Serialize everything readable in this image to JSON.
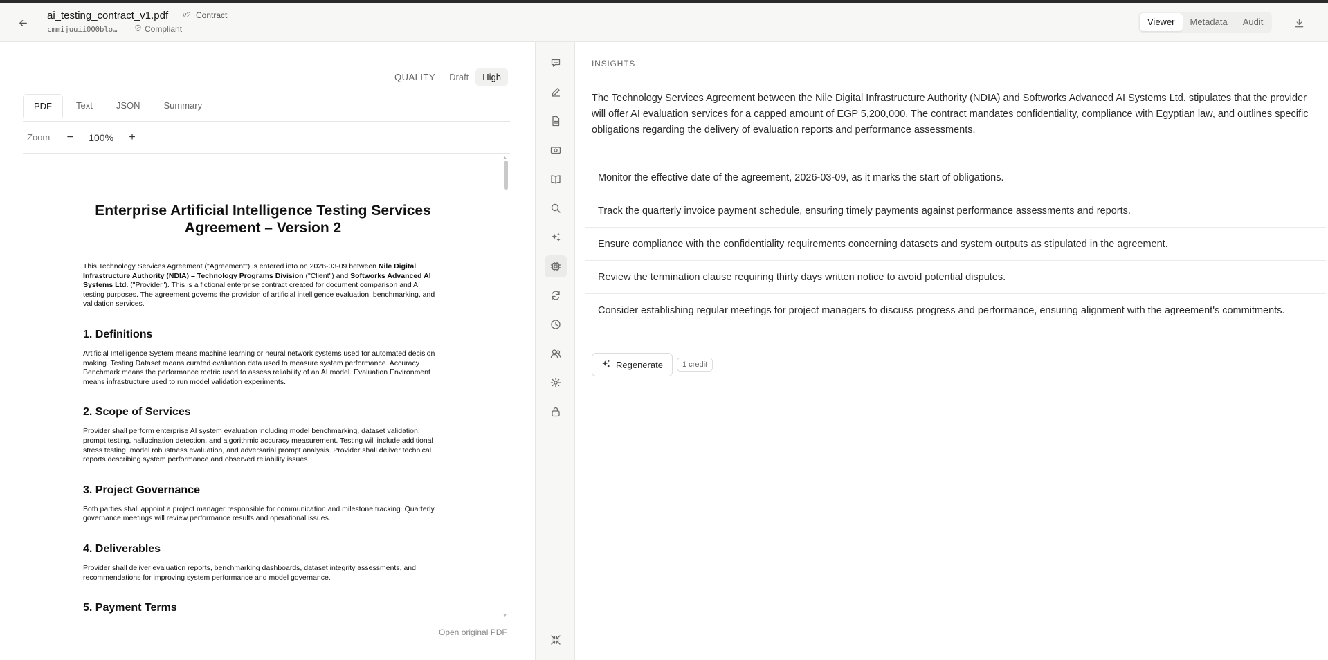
{
  "header": {
    "file_name": "ai_testing_contract_v1.pdf",
    "version": "v2",
    "doc_type": "Contract",
    "file_id": "cmmijuuii000blo…",
    "status": "Compliant",
    "modes": [
      "Viewer",
      "Metadata",
      "Audit"
    ],
    "active_mode": "Viewer"
  },
  "left": {
    "quality_label": "QUALITY",
    "quality_options": [
      "Draft",
      "High"
    ],
    "quality_selected": "High",
    "tabs": [
      "PDF",
      "Text",
      "JSON",
      "Summary"
    ],
    "active_tab": "PDF",
    "zoom_label": "Zoom",
    "zoom_minus": "−",
    "zoom_value": "100%",
    "zoom_plus": "+",
    "open_original": "Open original PDF"
  },
  "document": {
    "title": "Enterprise Artificial Intelligence Testing Services Agreement – Version 2",
    "intro": {
      "part1": "This Technology Services Agreement (\"Agreement\") is entered into on 2026-03-09 between ",
      "client": "Nile Digital Infrastructure Authority (NDIA) – Technology Programs Division",
      "part2": " (\"Client\") and ",
      "provider": "Softworks Advanced AI Systems Ltd.",
      "part3": " (\"Provider\"). This is a fictional enterprise contract created for document comparison and AI testing purposes. The agreement governs the provision of artificial intelligence evaluation, benchmarking, and validation services."
    },
    "sections": [
      {
        "heading": "1. Definitions",
        "body": "Artificial Intelligence System means machine learning or neural network systems used for automated decision making. Testing Dataset means curated evaluation data used to measure system performance. Accuracy Benchmark means the performance metric used to assess reliability of an AI model. Evaluation Environment means infrastructure used to run model validation experiments."
      },
      {
        "heading": "2. Scope of Services",
        "body": "Provider shall perform enterprise AI system evaluation including model benchmarking, dataset validation, prompt testing, hallucination detection, and algorithmic accuracy measurement. Testing will include additional stress testing, model robustness evaluation, and adversarial prompt analysis. Provider shall deliver technical reports describing system performance and observed reliability issues."
      },
      {
        "heading": "3. Project Governance",
        "body": "Both parties shall appoint a project manager responsible for communication and milestone tracking. Quarterly governance meetings will review performance results and operational issues."
      },
      {
        "heading": "4. Deliverables",
        "body": "Provider shall deliver evaluation reports, benchmarking dashboards, dataset integrity assessments, and recommendations for improving system performance and model governance."
      },
      {
        "heading": "5. Payment Terms",
        "body": ""
      }
    ]
  },
  "tools": [
    "chat-icon",
    "edit-icon",
    "file-text-icon",
    "money-icon",
    "book-icon",
    "search-icon",
    "sparkles-icon",
    "chip-icon",
    "refresh-icon",
    "clock-icon",
    "users-icon",
    "gear-icon",
    "lock-icon",
    "collapse-icon"
  ],
  "insights": {
    "label": "INSIGHTS",
    "summary": "The Technology Services Agreement between the Nile Digital Infrastructure Authority (NDIA) and Softworks Advanced AI Systems Ltd. stipulates that the provider will offer AI evaluation services for a capped amount of EGP 5,200,000. The contract mandates confidentiality, compliance with Egyptian law, and outlines specific obligations regarding the delivery of evaluation reports and performance assessments.",
    "items": [
      "Monitor the effective date of the agreement, 2026-03-09, as it marks the start of obligations.",
      "Track the quarterly invoice payment schedule, ensuring timely payments against performance assessments and reports.",
      "Ensure compliance with the confidentiality requirements concerning datasets and system outputs as stipulated in the agreement.",
      "Review the termination clause requiring thirty days written notice to avoid potential disputes.",
      "Consider establishing regular meetings for project managers to discuss progress and performance, ensuring alignment with the agreement's commitments."
    ],
    "regenerate_label": "Regenerate",
    "credit_label": "1 credit"
  }
}
